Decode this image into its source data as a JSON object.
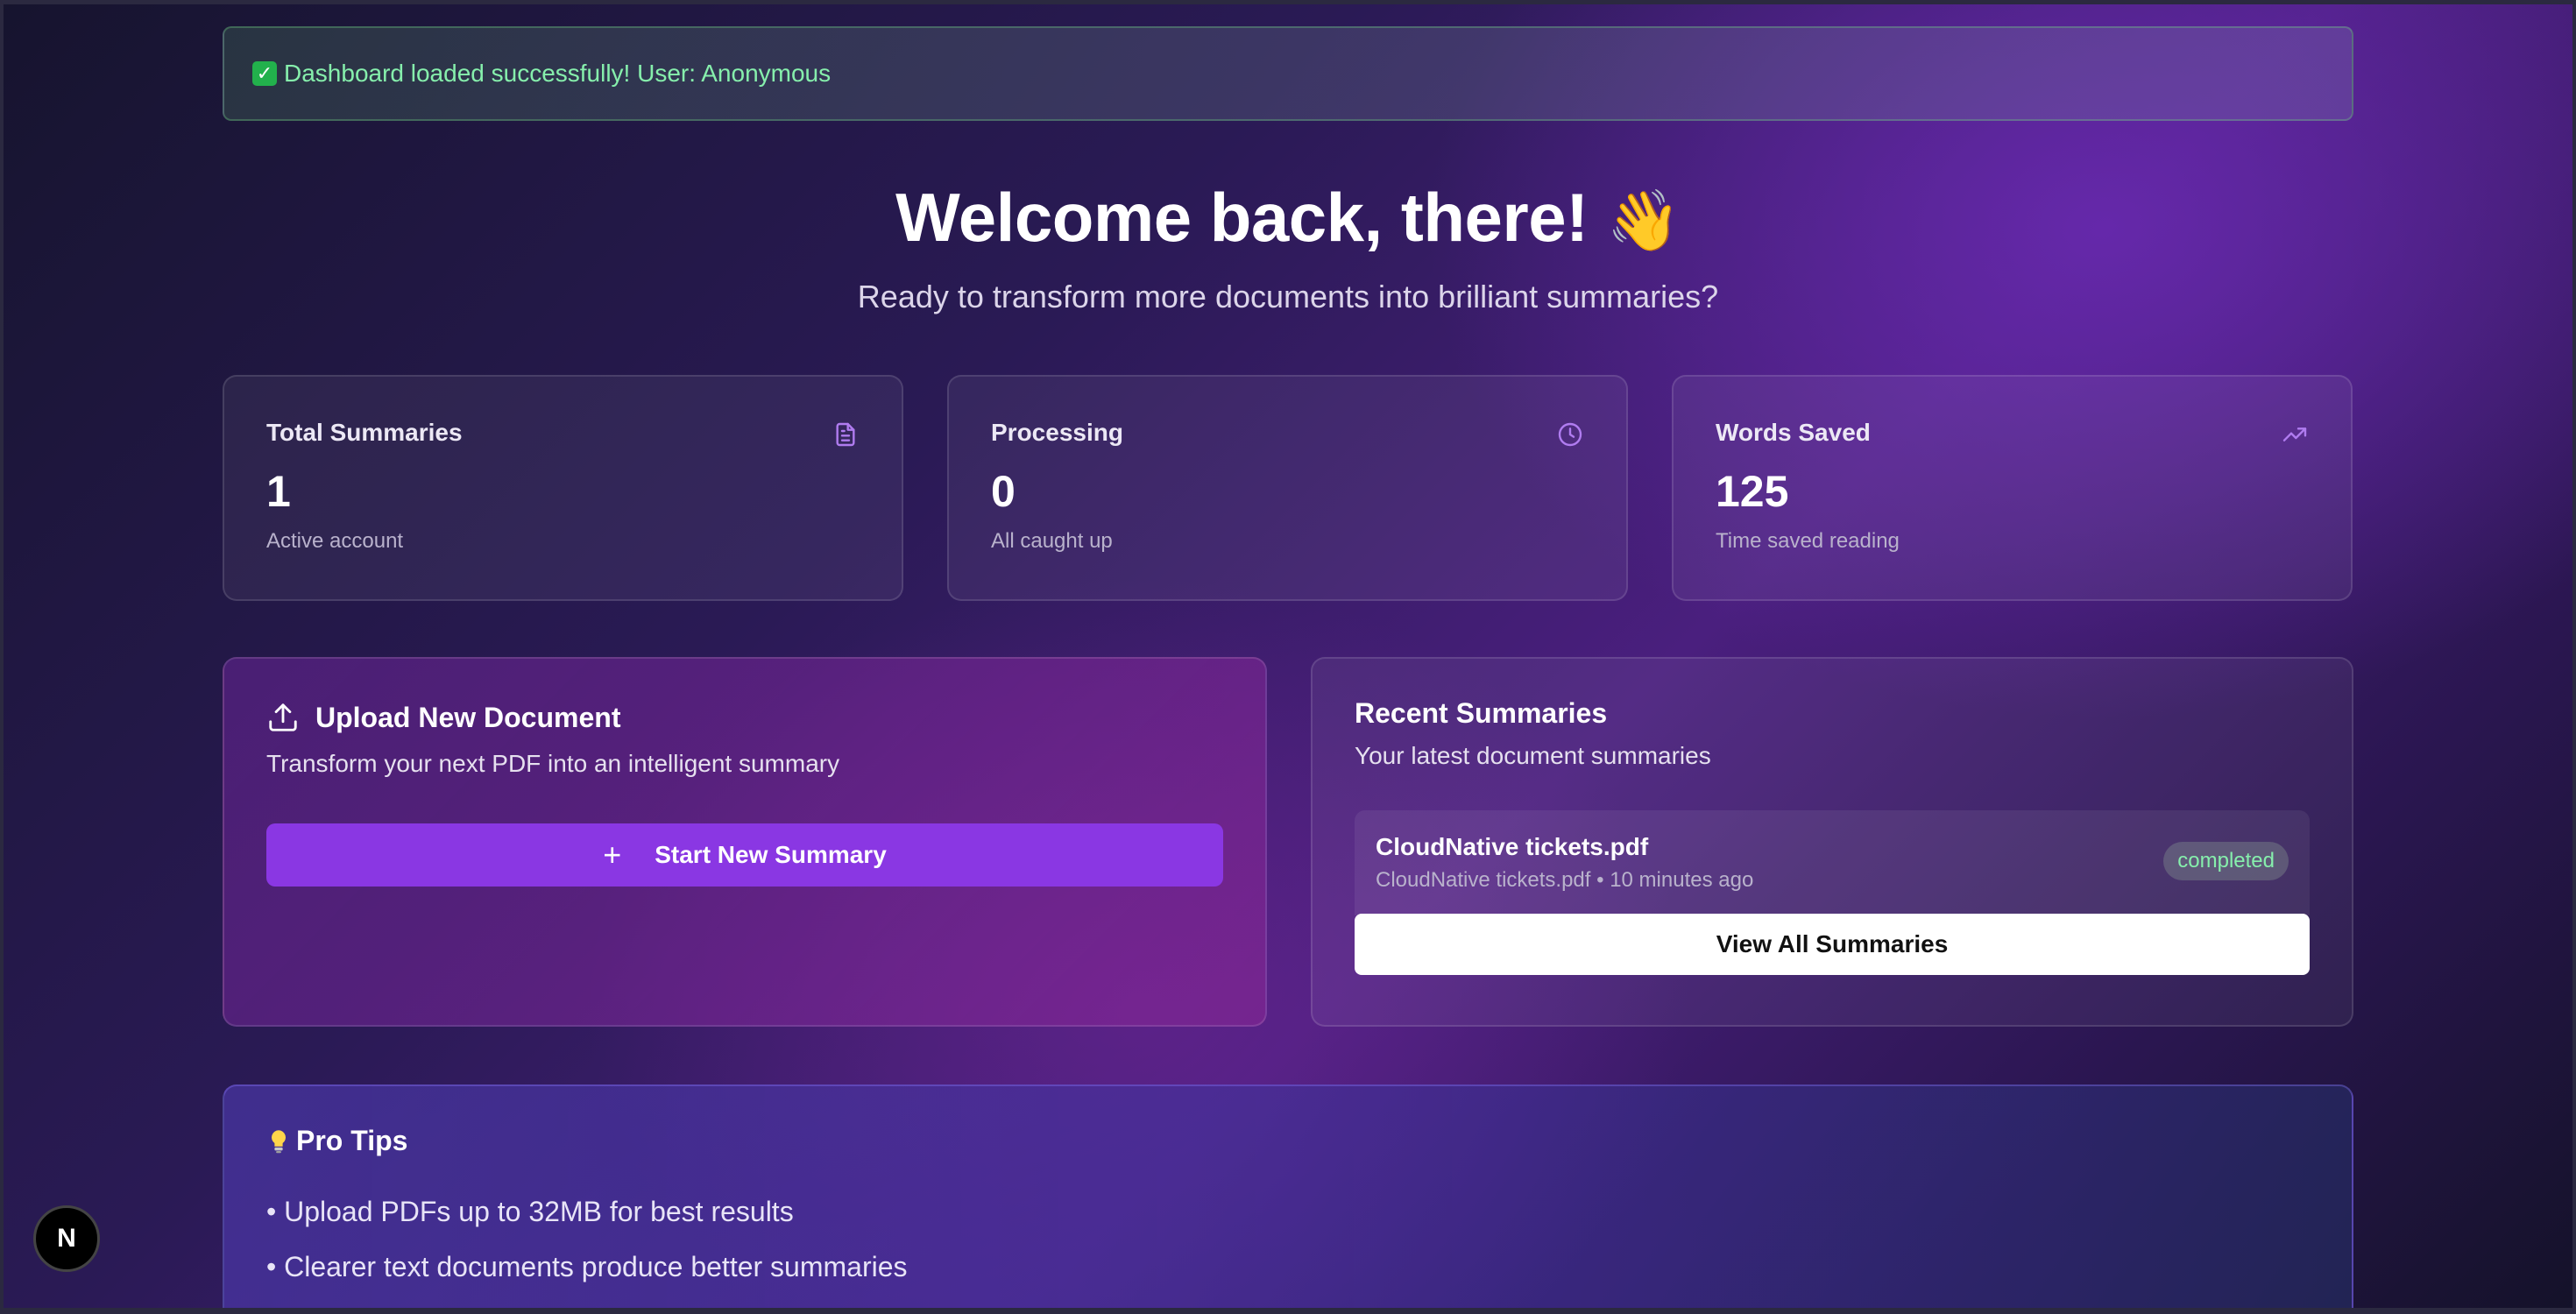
{
  "alert": {
    "icon": "check-icon",
    "text": "Dashboard loaded successfully! User: Anonymous"
  },
  "hero": {
    "title": "Welcome back, there!",
    "wave": "👋",
    "subtitle": "Ready to transform more documents into brilliant summaries?"
  },
  "stats": [
    {
      "label": "Total Summaries",
      "value": "1",
      "sub": "Active account",
      "icon": "document-icon"
    },
    {
      "label": "Processing",
      "value": "0",
      "sub": "All caught up",
      "icon": "clock-icon"
    },
    {
      "label": "Words Saved",
      "value": "125",
      "sub": "Time saved reading",
      "icon": "trending-up-icon"
    }
  ],
  "upload": {
    "title": "Upload New Document",
    "description": "Transform your next PDF into an intelligent summary",
    "button": "Start New Summary"
  },
  "recent": {
    "title": "Recent Summaries",
    "description": "Your latest document summaries",
    "items": [
      {
        "name": "CloudNative tickets.pdf",
        "meta": "CloudNative tickets.pdf • 10 minutes ago",
        "status": "completed"
      }
    ],
    "view_all": "View All Summaries"
  },
  "tips": {
    "title": "Pro Tips",
    "items": [
      "Upload PDFs up to 32MB for best results",
      "Clearer text documents produce better summaries"
    ]
  },
  "dev_badge": "N",
  "colors": {
    "accent": "#8a37e3",
    "success": "#86efac",
    "icon_purple": "#b07cf0"
  }
}
